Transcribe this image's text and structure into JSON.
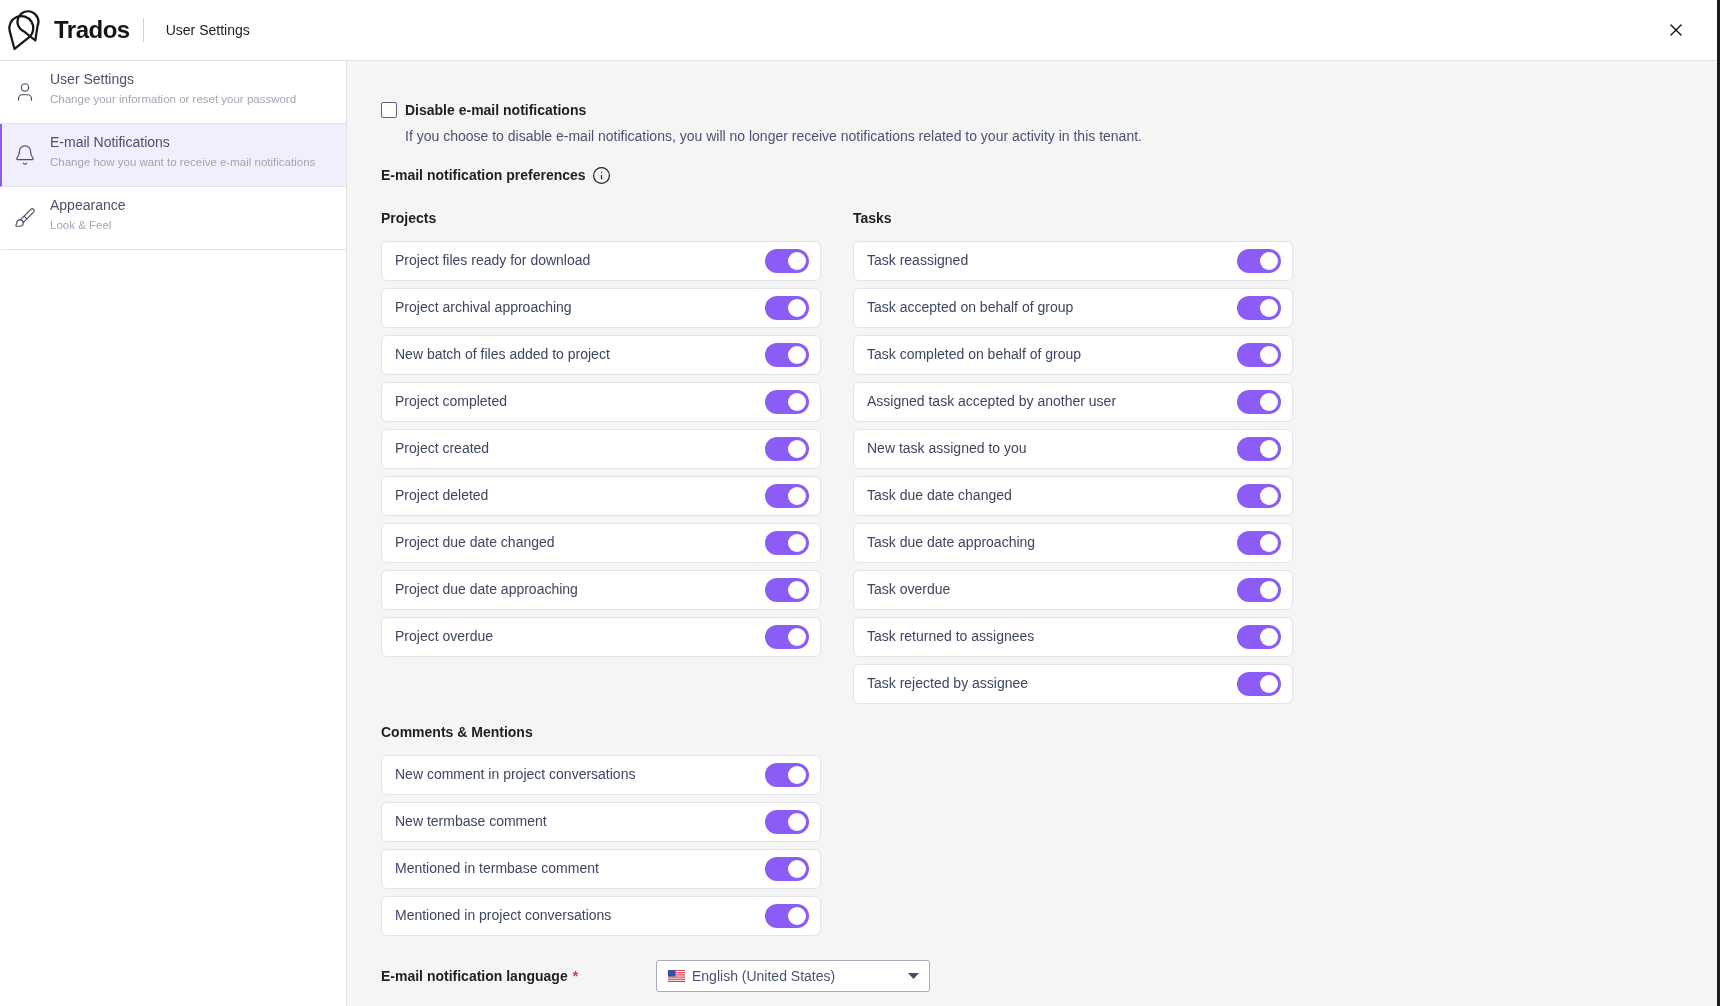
{
  "header": {
    "logo_text": "Trados",
    "title": "User Settings"
  },
  "sidebar": {
    "items": [
      {
        "kind": "profile",
        "title": "User Settings",
        "subtitle": "Change your information or reset your password",
        "selected": false
      },
      {
        "kind": "notifications",
        "title": "E-mail Notifications",
        "subtitle": "Change how you want to receive e-mail notifications",
        "selected": true
      },
      {
        "kind": "appearance",
        "title": "Appearance",
        "subtitle": "Look & Feel",
        "selected": false
      }
    ]
  },
  "disable_notifications": {
    "label": "Disable e-mail notifications",
    "checked": false,
    "description": "If you choose to disable e-mail notifications, you will no longer receive notifications related to your activity in this tenant."
  },
  "preferences": {
    "title": "E-mail notification preferences",
    "groups": [
      {
        "title": "Projects",
        "items": [
          {
            "label": "Project files ready for download",
            "on": true
          },
          {
            "label": "Project archival approaching",
            "on": true
          },
          {
            "label": "New batch of files added to project",
            "on": true
          },
          {
            "label": "Project completed",
            "on": true
          },
          {
            "label": "Project created",
            "on": true
          },
          {
            "label": "Project deleted",
            "on": true
          },
          {
            "label": "Project due date changed",
            "on": true
          },
          {
            "label": "Project due date approaching",
            "on": true
          },
          {
            "label": "Project overdue",
            "on": true
          }
        ]
      },
      {
        "title": "Tasks",
        "items": [
          {
            "label": "Task reassigned",
            "on": true
          },
          {
            "label": "Task accepted on behalf of group",
            "on": true
          },
          {
            "label": "Task completed on behalf of group",
            "on": true
          },
          {
            "label": "Assigned task accepted by another user",
            "on": true
          },
          {
            "label": "New task assigned to you",
            "on": true
          },
          {
            "label": "Task due date changed",
            "on": true
          },
          {
            "label": "Task due date approaching",
            "on": true
          },
          {
            "label": "Task overdue",
            "on": true
          },
          {
            "label": "Task returned to assignees",
            "on": true
          },
          {
            "label": "Task rejected by assignee",
            "on": true
          }
        ]
      },
      {
        "title": "Comments & Mentions",
        "items": [
          {
            "label": "New comment in project conversations",
            "on": true
          },
          {
            "label": "New termbase comment",
            "on": true
          },
          {
            "label": "Mentioned in termbase comment",
            "on": true
          },
          {
            "label": "Mentioned in project conversations",
            "on": true
          }
        ]
      }
    ]
  },
  "language": {
    "label": "E-mail notification language",
    "required_mark": "*",
    "value": "English (United States)"
  }
}
